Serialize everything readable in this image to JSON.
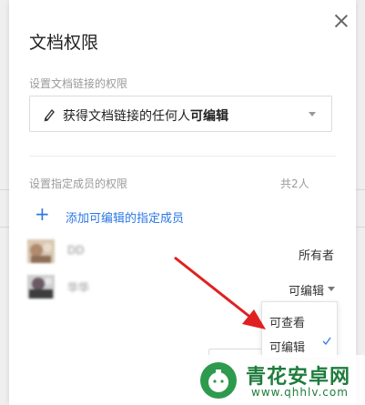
{
  "dialog": {
    "title": "文档权限",
    "close_icon": "close-icon"
  },
  "link_permission": {
    "section_label": "设置文档链接的权限",
    "icon": "pencil-icon",
    "prefix": "获得文档链接的任何人",
    "level": "可编辑"
  },
  "member_permission": {
    "section_label": "设置指定成员的权限",
    "count": "共2人",
    "add_label": "添加可编辑的指定成员",
    "members": [
      {
        "name": "DD",
        "role": "所有者"
      },
      {
        "name": "华华",
        "role": "可编辑"
      }
    ]
  },
  "role_dropdown": {
    "options": [
      "可查看",
      "可编辑"
    ],
    "selected": "可编辑"
  },
  "watermark": {
    "name": "青花安卓网",
    "url": "www.qhhlv.com"
  },
  "colors": {
    "accent": "#2b78e4",
    "arrow": "#e02020",
    "watermark": "#1e7c3c"
  }
}
